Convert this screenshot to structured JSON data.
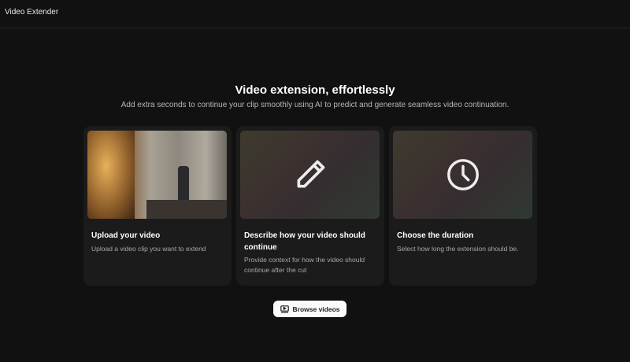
{
  "app": {
    "title": "Video Extender"
  },
  "hero": {
    "title": "Video extension, effortlessly",
    "subtitle": "Add extra seconds to continue your clip smoothly using AI to predict and generate seamless video continuation."
  },
  "steps": [
    {
      "title": "Upload your video",
      "description": "Upload a video clip you want to extend",
      "icon": "video-thumbnail"
    },
    {
      "title": "Describe how your video should continue",
      "description": "Provide context for how the video should continue after the cut",
      "icon": "pencil-icon"
    },
    {
      "title": "Choose the duration",
      "description": "Select how long the extension should be.",
      "icon": "clock-icon"
    }
  ],
  "actions": {
    "browse_label": "Browse videos",
    "browse_icon": "video-library-icon"
  }
}
